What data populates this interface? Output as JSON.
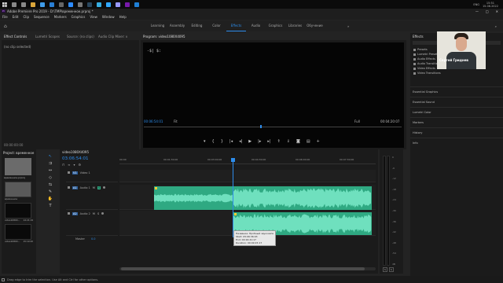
{
  "taskbar": {
    "time": "15:51",
    "date": "15.06.2022",
    "lang": "ENG"
  },
  "window": {
    "title": "Adobe Premiere Pro 2019 - D:\\TMP\\временное.prproj *"
  },
  "menu": [
    "File",
    "Edit",
    "Clip",
    "Sequence",
    "Markers",
    "Graphics",
    "View",
    "Window",
    "Help"
  ],
  "workspaces": [
    "Learning",
    "Assembly",
    "Editing",
    "Color",
    "Effects",
    "Audio",
    "Graphics",
    "Libraries",
    "Обучение"
  ],
  "workspaces_active": "Effects",
  "source_tabs": [
    "Effect Controls",
    "Lumetri Scopes",
    "Source: (no clips)",
    "Audio Clip Mixer: video1"
  ],
  "effect_controls": {
    "empty_text": "(no clip selected)",
    "timecode": "00:00:00:00"
  },
  "program": {
    "tab": "Program: video1080X4095",
    "timecode": "00:06:54:01",
    "fit": "Fit",
    "quality": "Full",
    "duration": "00:04:20:07"
  },
  "effects_panel": {
    "title": "Effects",
    "items": [
      "Presets",
      "Lumetri Presets",
      "Audio Effects",
      "Audio Transitions",
      "Video Effects",
      "Video Transitions"
    ],
    "sections": [
      "Essential Graphics",
      "Essential Sound",
      "Lumetri Color",
      "Markers",
      "History",
      "Info"
    ]
  },
  "webcam": {
    "caption": "Сергей Гриднев"
  },
  "project": {
    "tab": "Project: временное",
    "bin_label": "временное.prproj",
    "items": [
      {
        "name": "временное",
        "meta": ""
      },
      {
        "name": "video1080X...",
        "meta": "14:21:19"
      },
      {
        "name": "video1080X...",
        "meta": "15:19:20"
      }
    ]
  },
  "timeline": {
    "tab": "video1080X4095",
    "timecode": "03:06:54:01",
    "ruler": [
      "00:00",
      "00:01:30:00",
      "00:03:00:00",
      "00:04:30:00",
      "00:06:00:00",
      "00:07:30:00"
    ],
    "tracks": [
      {
        "id": "V1",
        "label": "Video 1"
      },
      {
        "id": "A1",
        "label": "Audio 1"
      },
      {
        "id": "A2",
        "label": "Audio 2"
      }
    ],
    "master": {
      "label": "Master",
      "value": "0.0"
    },
    "tooltip": [
      "Название: Пробный звукозапись.wav",
      "Start: 05:06:36:03",
      "End: 00:16:41:17",
      "Duration: 00:09:15:17"
    ],
    "meter_labels": [
      "0",
      "-6",
      "-12",
      "-18",
      "-24",
      "-30",
      "-36",
      "-42",
      "-48",
      "-54",
      "dB"
    ],
    "meter_footer": [
      "S",
      "S"
    ]
  },
  "status": {
    "text": "Drag edge to trim the selection. Use Alt and Ctrl for other options."
  },
  "colors": {
    "accent": "#2d8ceb",
    "audio_clip": "#2fa982",
    "audio_wave": "#6fe0be",
    "bg": "#1b1b1b"
  }
}
